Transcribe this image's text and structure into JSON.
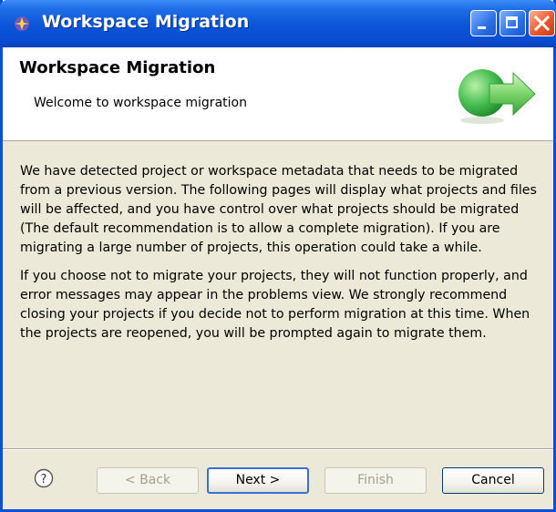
{
  "window": {
    "title": "Workspace Migration",
    "controls": {
      "minimize": "minimize-icon",
      "maximize": "maximize-icon",
      "close": "close-icon"
    }
  },
  "header": {
    "title": "Workspace Migration",
    "subtitle": "Welcome to workspace migration",
    "graphic": "arrow-right-icon"
  },
  "body": {
    "paragraphs": [
      "We have detected project or workspace metadata that needs to be migrated from a previous version. The following pages will display what projects and files will be affected, and you have control over what projects should be migrated (The default recommendation is to allow a complete migration). If you are migrating a large number of projects, this operation could take a while.",
      "If you choose not to migrate your projects, they will not function properly, and  error messages may appear in the problems view. We strongly recommend closing your projects if you decide not to perform migration at this time. When the projects are reopened, you will be prompted again to migrate them."
    ]
  },
  "footer": {
    "help_icon": "help-icon",
    "back_label": "< Back",
    "next_label": "Next >",
    "finish_label": "Finish",
    "cancel_label": "Cancel"
  },
  "colors": {
    "titlebar": "#0a54d8",
    "dialog_bg": "#ece9d8",
    "header_bg": "#ffffff",
    "arrow_green": "#3fb548"
  }
}
